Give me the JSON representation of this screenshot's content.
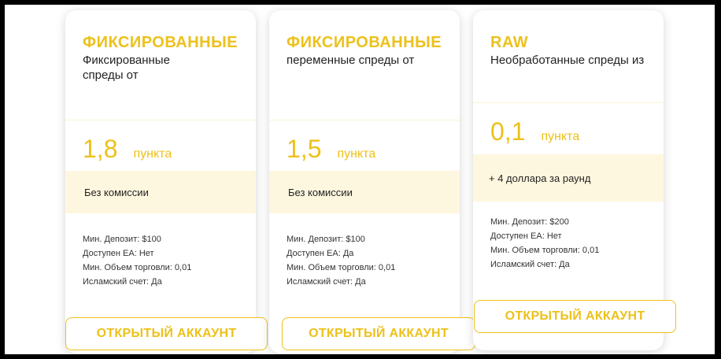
{
  "plans": [
    {
      "name": "ФИКСИРОВАННЫЕ",
      "description": "Фиксированные спреды от",
      "spread_value": "1,8",
      "spread_unit": "пункта",
      "commission": "Без комиссии",
      "details": [
        "Мин. Депозит: $100",
        "Доступен EA: Нет",
        "Мин. Объем торговли: 0,01",
        "Исламский счет: Да"
      ],
      "button_label": "ОТКРЫТЫЙ АККАУНТ"
    },
    {
      "name": "ФИКСИРОВАННЫЕ",
      "description": "переменные спреды от",
      "spread_value": "1,5",
      "spread_unit": "пункта",
      "commission": "Без комиссии",
      "details": [
        "Мин. Депозит: $100",
        "Доступен EA: Да",
        "Мин. Объем торговли: 0,01",
        "Исламский счет: Да"
      ],
      "button_label": "ОТКРЫТЫЙ АККАУНТ"
    },
    {
      "name": "RAW",
      "description": "Необработанные спреды из",
      "spread_value": "0,1",
      "spread_unit": "пункта",
      "commission": "+ 4 доллара за раунд",
      "details": [
        "Мин. Депозит: $200",
        "Доступен EA: Нет",
        "Мин. Объем торговли: 0,01",
        "Исламский счет: Да"
      ],
      "button_label": "ОТКРЫТЫЙ АККАУНТ"
    }
  ],
  "colors": {
    "accent": "#ECC11B",
    "band": "#FEF7DF",
    "text": "#222222"
  }
}
